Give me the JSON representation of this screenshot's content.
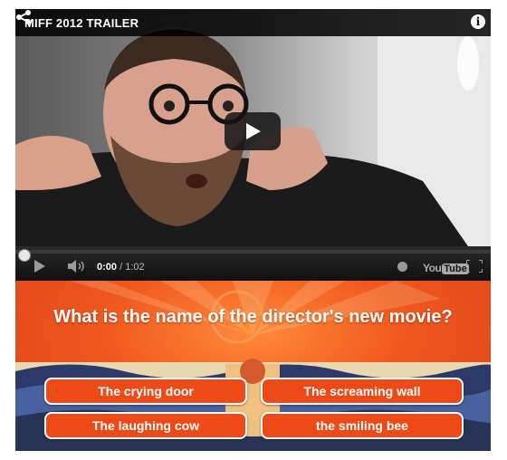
{
  "video": {
    "title": "MIFF 2012 TRAILER",
    "time_current": "0:00",
    "time_separator": " / ",
    "time_total": "1:02",
    "progress_fraction": 0.0,
    "logo_you": "You",
    "logo_tube": "Tube"
  },
  "icons": [
    "share-icon",
    "info-icon",
    "play-icon",
    "volume-icon",
    "clock-icon",
    "fullscreen-icon"
  ],
  "quiz": {
    "question": "What is the name of the director's new movie?",
    "answers": [
      "The crying door",
      "The screaming wall",
      "The laughing cow",
      "the smiling bee"
    ]
  },
  "colors": {
    "quiz_orange": "#ee4a18",
    "player_black": "#000000"
  }
}
